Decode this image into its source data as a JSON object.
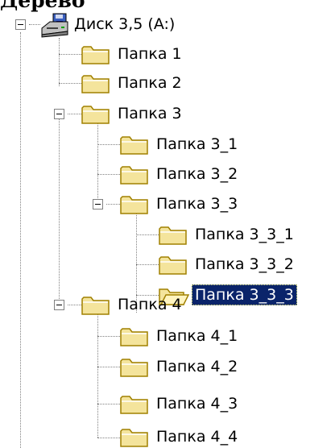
{
  "header": {
    "cut_text": "Дерево"
  },
  "tree": {
    "root": {
      "label": "Диск 3,5 (A:)",
      "icon": "floppy-drive-icon"
    },
    "nodes": [
      {
        "label": "Папка 1",
        "icon": "folder-icon"
      },
      {
        "label": "Папка 2",
        "icon": "folder-icon"
      },
      {
        "label": "Папка 3",
        "icon": "folder-icon"
      },
      {
        "label": "Папка 3_1",
        "icon": "folder-icon"
      },
      {
        "label": "Папка 3_2",
        "icon": "folder-icon"
      },
      {
        "label": "Папка 3_3",
        "icon": "folder-icon"
      },
      {
        "label": "Папка 3_3_1",
        "icon": "folder-icon"
      },
      {
        "label": "Папка 3_3_2",
        "icon": "folder-icon"
      },
      {
        "label": "Папка 3_3_3",
        "icon": "open-folder-icon",
        "selected": true
      },
      {
        "label": "Папка 4",
        "icon": "folder-icon"
      },
      {
        "label": "Папка 4_1",
        "icon": "folder-icon"
      },
      {
        "label": "Папка 4_2",
        "icon": "folder-icon"
      },
      {
        "label": "Папка 4_3",
        "icon": "folder-icon"
      },
      {
        "label": "Папка 4_4",
        "icon": "folder-icon"
      }
    ]
  },
  "colors": {
    "selection_bg": "#0a246a",
    "selection_text": "#ffffff",
    "folder_fill": "#f4e49c",
    "folder_edge": "#a08000",
    "tree_lines": "#808080"
  }
}
